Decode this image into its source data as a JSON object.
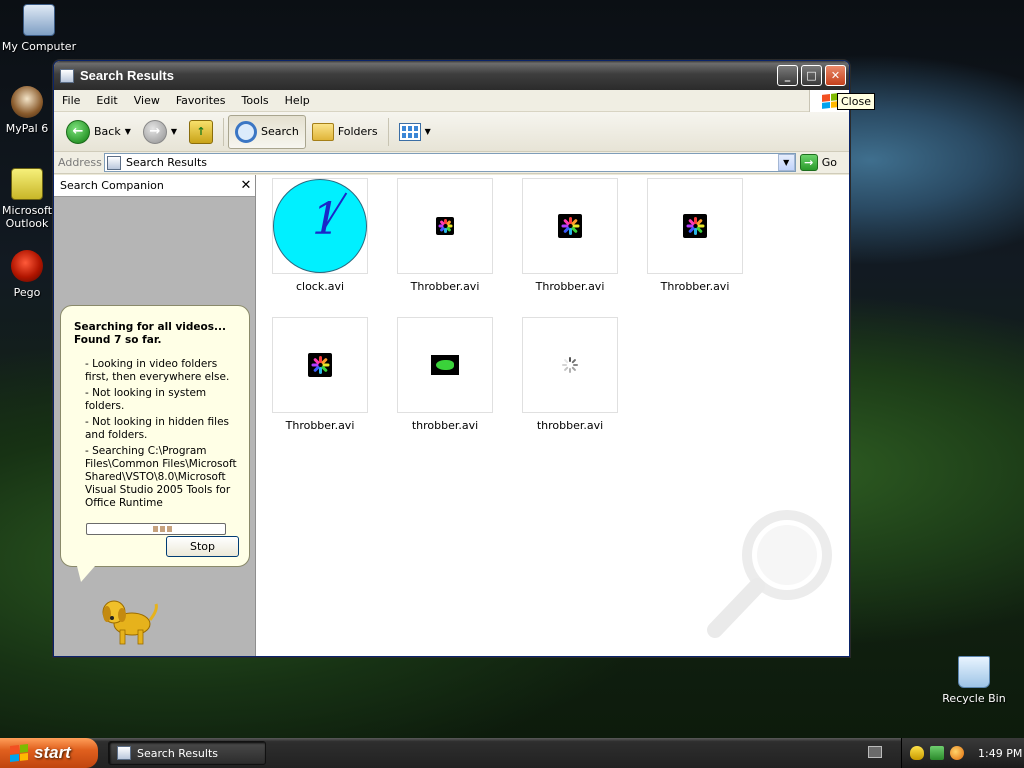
{
  "desktop": {
    "icons": [
      {
        "label": "My Computer"
      },
      {
        "label": "MyPal 6"
      },
      {
        "label": "Microsoft Outlook"
      },
      {
        "label": "Pego"
      },
      {
        "label": "Recycle Bin"
      }
    ]
  },
  "window": {
    "title": "Search Results",
    "close_tooltip": "Close",
    "minimize_glyph": "_",
    "maximize_glyph": "□",
    "close_glyph": "✕"
  },
  "menu": [
    "File",
    "Edit",
    "View",
    "Favorites",
    "Tools",
    "Help"
  ],
  "toolbar": {
    "back_label": "Back",
    "search_label": "Search",
    "folders_label": "Folders"
  },
  "address": {
    "label": "Address",
    "value": "Search Results",
    "go_label": "Go"
  },
  "companion": {
    "title": "Search Companion",
    "heading_line1": "Searching for all videos...",
    "heading_line2": "Found 7 so far.",
    "lines": [
      "- Looking in video folders first, then everywhere else.",
      "- Not looking in system folders.",
      "- Not looking in hidden files and folders.",
      "- Searching C:\\Program Files\\Common Files\\Microsoft Shared\\VSTO\\8.0\\Microsoft Visual Studio 2005 Tools for Office Runtime"
    ],
    "stop_label": "Stop"
  },
  "results": [
    {
      "name": "clock.avi",
      "thumb": "clock"
    },
    {
      "name": "Throbber.avi",
      "thumb": "throbber-small"
    },
    {
      "name": "Throbber.avi",
      "thumb": "throbber"
    },
    {
      "name": "Throbber.avi",
      "thumb": "throbber"
    },
    {
      "name": "Throbber.avi",
      "thumb": "throbber"
    },
    {
      "name": "throbber.avi",
      "thumb": "gecko"
    },
    {
      "name": "throbber.avi",
      "thumb": "spinner"
    }
  ],
  "taskbar": {
    "start_label": "start",
    "task_label": "Search Results",
    "clock": "1:49 PM"
  }
}
